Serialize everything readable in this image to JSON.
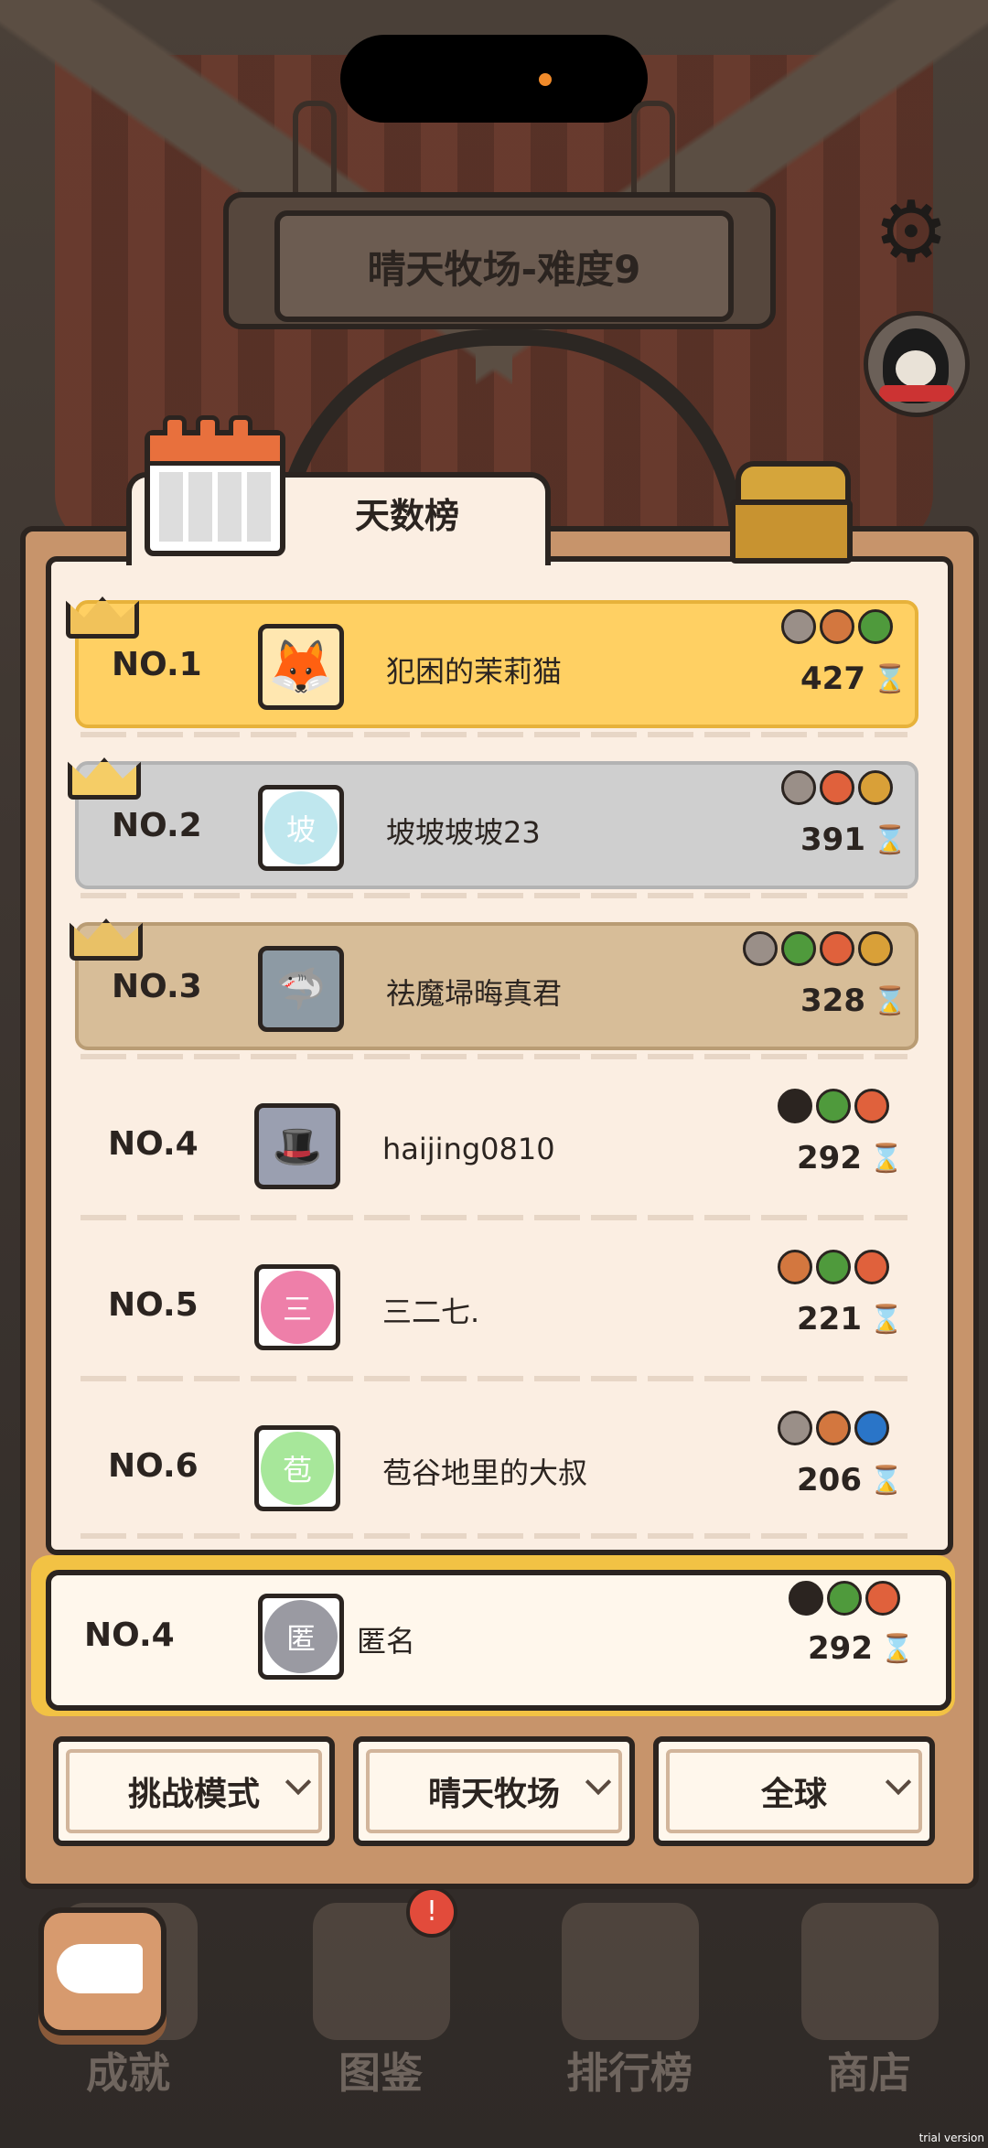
{
  "sign": {
    "title": "晴天牧场-难度9"
  },
  "tab": {
    "label": "天数榜"
  },
  "leaderboard": [
    {
      "rank": "NO.1",
      "name": "犯困的茉莉猫",
      "score": "427",
      "avatar_text": "",
      "avatar_type": "fox",
      "tier": "gold",
      "pets": [
        "#9a8f88",
        "#d3773f",
        "#4f9a3c"
      ]
    },
    {
      "rank": "NO.2",
      "name": "坡坡坡坡23",
      "score": "391",
      "avatar_text": "坡",
      "avatar_color": "#bfe7ee",
      "tier": "silver",
      "pets": [
        "#9a8f88",
        "#e0613c",
        "#d9a038"
      ]
    },
    {
      "rank": "NO.3",
      "name": "祛魔埽晦真君",
      "score": "328",
      "avatar_text": "",
      "avatar_type": "shark",
      "tier": "bronze",
      "pets": [
        "#9a8f88",
        "#4f9a3c",
        "#e0613c",
        "#d9a038"
      ]
    },
    {
      "rank": "NO.4",
      "name": "haijing0810",
      "score": "292",
      "avatar_text": "",
      "avatar_type": "hat",
      "tier": "plain",
      "pets": [
        "#2b2420",
        "#4f9a3c",
        "#e0613c"
      ]
    },
    {
      "rank": "NO.5",
      "name": "三二七.",
      "score": "221",
      "avatar_text": "三",
      "avatar_color": "#ee7fa9",
      "tier": "plain",
      "pets": [
        "#d3773f",
        "#4f9a3c",
        "#e0613c"
      ]
    },
    {
      "rank": "NO.6",
      "name": "苞谷地里的大叔",
      "score": "206",
      "avatar_text": "苞",
      "avatar_color": "#a7e79a",
      "tier": "plain",
      "pets": [
        "#9a8f88",
        "#d3773f",
        "#2a75c8"
      ]
    }
  ],
  "self": {
    "rank": "NO.4",
    "name": "匿名",
    "score": "292",
    "avatar_text": "匿",
    "avatar_color": "#9a9aa2",
    "pets": [
      "#2b2420",
      "#4f9a3c",
      "#e0613c"
    ]
  },
  "filters": {
    "mode": "挑战模式",
    "map": "晴天牧场",
    "region": "全球"
  },
  "nav": {
    "achievements": "成就",
    "codex": "图鉴",
    "ranking": "排行榜",
    "shop": "商店",
    "alert": "!"
  },
  "watermark": "trial version",
  "colors": {
    "accent": "#ffd063",
    "panel": "#c7946b",
    "paper": "#fbeee2"
  }
}
